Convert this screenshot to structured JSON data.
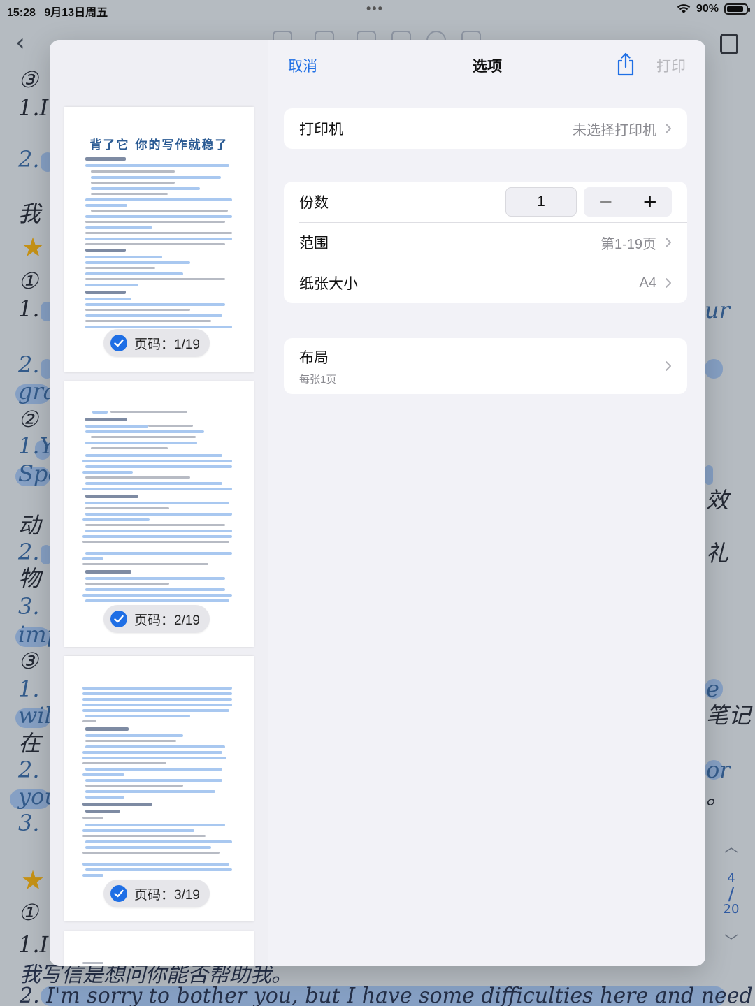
{
  "status_bar": {
    "time": "15:28",
    "date": "9月13日周五",
    "battery": "90%",
    "battery_level": 0.9
  },
  "background": {
    "page_nav": {
      "current": "4",
      "total": "20"
    },
    "margin_text": [
      "③",
      "1.I",
      "2.",
      "我",
      "①",
      "1.",
      "2.",
      "gra",
      "②",
      "1.Y",
      "Spe",
      "动",
      "2.",
      "物",
      "3.",
      "imp",
      "③",
      "1.",
      "wil",
      "在",
      "2.",
      "you",
      "3.",
      "①",
      "1.I'"
    ],
    "right_text": [
      "ur",
      "效",
      "礼",
      "e",
      "笔记",
      "or",
      "。"
    ],
    "bottom_lines": [
      "我写信是想问你能否帮助我。",
      "2. I'm sorry to bother you, but I have some difficulties here and need"
    ]
  },
  "dialog": {
    "nav": {
      "cancel": "取消",
      "title": "选项",
      "share_icon": "share-icon",
      "print": "打印"
    },
    "printer": {
      "label": "打印机",
      "value": "未选择打印机"
    },
    "copies": {
      "label": "份数",
      "value": "1",
      "minus": "−",
      "plus": "+"
    },
    "range": {
      "label": "范围",
      "value": "第1-19页"
    },
    "paper": {
      "label": "纸张大小",
      "value": "A4"
    },
    "layout": {
      "label": "布局",
      "sub": "每张1页"
    }
  },
  "thumbnails": [
    {
      "badge": "页码：1/19",
      "title": "背了它  你的写作就稳了",
      "selected": true
    },
    {
      "badge": "页码：2/19",
      "selected": true
    },
    {
      "badge": "页码：3/19",
      "selected": true
    }
  ],
  "colors": {
    "accent": "#1f6fe5",
    "disabled": "#b8b8bd",
    "highlight": "#9dc0ef"
  }
}
